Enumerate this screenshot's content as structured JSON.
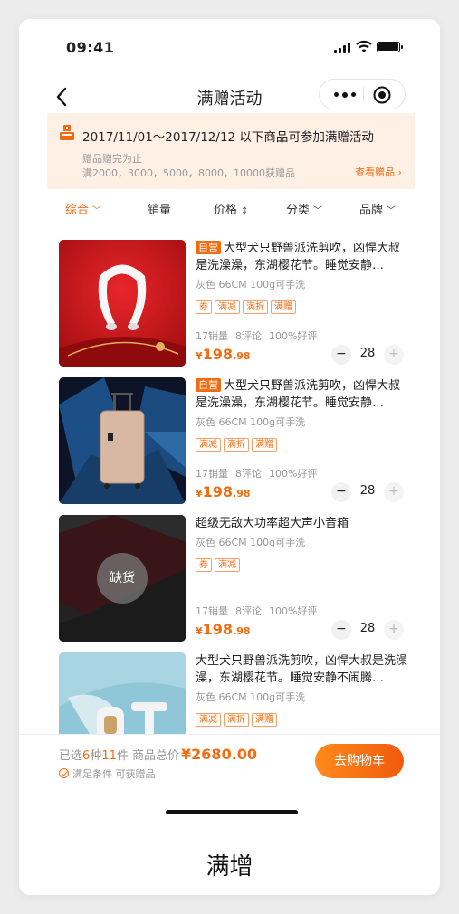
{
  "status_bar": {
    "time": "09:41"
  },
  "nav": {
    "title": "满赠活动"
  },
  "banner": {
    "title": "2017/11/01～2017/12/12 以下商品可参加满赠活动",
    "note": "赠品赠完为止",
    "thresholds": "满2000，3000，5000，8000，10000获赠品",
    "link": "查看赠品"
  },
  "filters": [
    {
      "label": "综合",
      "arrow": "﹀",
      "active": true
    },
    {
      "label": "销量",
      "arrow": "",
      "active": false
    },
    {
      "label": "价格",
      "arrow": "⇕",
      "active": false
    },
    {
      "label": "分类",
      "arrow": "﹀",
      "active": false
    },
    {
      "label": "品牌",
      "arrow": "﹀",
      "active": false
    }
  ],
  "products": [
    {
      "self_tag": "自营",
      "title": "大型犬只野兽派洗剪吹，凶悍大叔是洗澡澡，东湖樱花节。睡觉安静…",
      "spec": "灰色 66CM 100g可手洗",
      "tags": [
        "券",
        "满减",
        "满折",
        "满赠"
      ],
      "sales": "17销量",
      "reviews": "8评论",
      "rating": "100%好评",
      "price_symbol": "¥",
      "price_int": "198",
      "price_dec": ".98",
      "qty": "28",
      "minus": "−",
      "plus": "+"
    },
    {
      "self_tag": "自营",
      "title": "大型犬只野兽派洗剪吹，凶悍大叔是洗澡澡，东湖樱花节。睡觉安静…",
      "spec": "灰色 66CM 100g可手洗",
      "tags": [
        "满减",
        "满折",
        "满赠"
      ],
      "sales": "17销量",
      "reviews": "8评论",
      "rating": "100%好评",
      "price_symbol": "¥",
      "price_int": "198",
      "price_dec": ".98",
      "qty": "28",
      "minus": "−",
      "plus": "+"
    },
    {
      "title": "超级无敌大功率超大声小音箱",
      "spec": "灰色 66CM 100g可手洗",
      "tags": [
        "券",
        "满减"
      ],
      "sales": "17销量",
      "reviews": "8评论",
      "rating": "100%好评",
      "price_symbol": "¥",
      "price_int": "198",
      "price_dec": ".98",
      "qty": "28",
      "minus": "−",
      "plus": "+",
      "badge": "缺货"
    },
    {
      "title": "大型犬只野兽派洗剪吹，凶悍大叔是洗澡澡，东湖樱花节。睡觉安静不闹腾…",
      "spec": "灰色 66CM 100g可手洗",
      "tags": [
        "满减",
        "满折",
        "满赠"
      ]
    }
  ],
  "footer": {
    "selected_prefix": "已选",
    "kinds": "6",
    "kinds_unit": "种",
    "pieces": "11",
    "pieces_unit": "件",
    "total_label": "商品总价",
    "total": "¥2680.00",
    "condition": "满足条件 可获赠品",
    "cart_button": "去购物车"
  },
  "caption": "满增",
  "colors": {
    "accent": "#f26b10",
    "banner_bg": "#fff0e6"
  }
}
